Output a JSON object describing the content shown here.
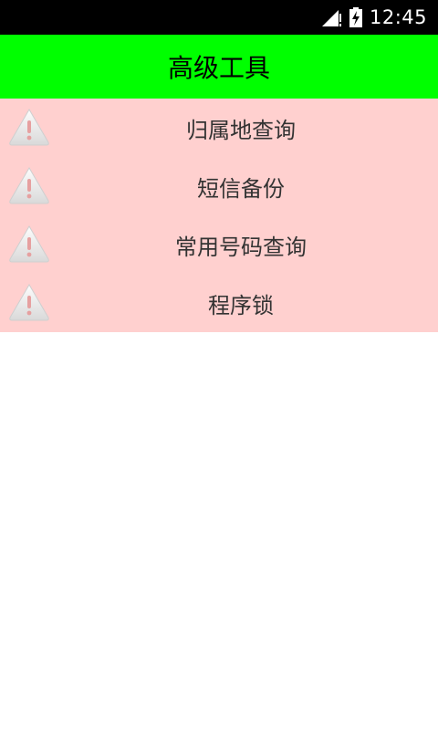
{
  "status_bar": {
    "time": "12:45",
    "signal_icon": "signal-no-data-icon",
    "battery_icon": "battery-charging-icon"
  },
  "header": {
    "title": "高级工具"
  },
  "tools": [
    {
      "label": "归属地查询",
      "icon": "warning-icon"
    },
    {
      "label": "短信备份",
      "icon": "warning-icon"
    },
    {
      "label": "常用号码查询",
      "icon": "warning-icon"
    },
    {
      "label": "程序锁",
      "icon": "warning-icon"
    }
  ],
  "colors": {
    "header_bg": "#00ff00",
    "list_bg": "#ffd0cf",
    "status_bg": "#000000"
  }
}
